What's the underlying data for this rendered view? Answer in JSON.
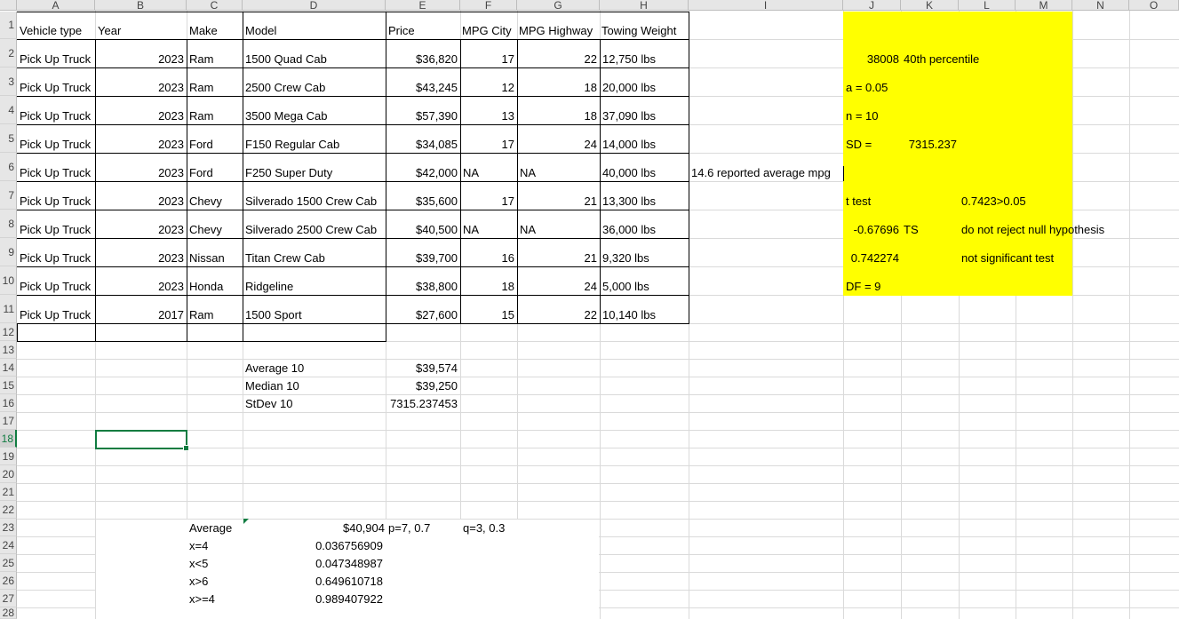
{
  "columns": [
    "A",
    "B",
    "C",
    "D",
    "E",
    "F",
    "G",
    "H",
    "I",
    "J",
    "K",
    "L",
    "M",
    "N",
    "O"
  ],
  "rows": [
    "1",
    "2",
    "3",
    "4",
    "5",
    "6",
    "7",
    "8",
    "9",
    "10",
    "11",
    "12",
    "13",
    "14",
    "15",
    "16",
    "17",
    "18",
    "19",
    "20",
    "21",
    "22",
    "23",
    "24",
    "25",
    "26",
    "27",
    "28"
  ],
  "selected_row": "18",
  "headers": {
    "vehicle_type": "Vehicle type",
    "year": "Year",
    "make": "Make",
    "model": "Model",
    "price": "Price",
    "mpg_city": "MPG City",
    "mpg_highway": "MPG Highway",
    "towing": "Towing Weight"
  },
  "trucks": [
    {
      "type": "Pick Up Truck",
      "year": "2023",
      "make": "Ram",
      "model": "1500 Quad Cab",
      "price": "$36,820",
      "city": "17",
      "hwy": "22",
      "tow": "12,750 lbs"
    },
    {
      "type": "Pick Up Truck",
      "year": "2023",
      "make": "Ram",
      "model": "2500 Crew Cab",
      "price": "$43,245",
      "city": "12",
      "hwy": "18",
      "tow": "20,000 lbs"
    },
    {
      "type": "Pick Up Truck",
      "year": "2023",
      "make": "Ram",
      "model": "3500 Mega Cab",
      "price": "$57,390",
      "city": "13",
      "hwy": "18",
      "tow": "37,090 lbs"
    },
    {
      "type": "Pick Up Truck",
      "year": "2023",
      "make": "Ford",
      "model": "F150 Regular Cab",
      "price": "$34,085",
      "city": "17",
      "hwy": "24",
      "tow": "14,000 lbs"
    },
    {
      "type": "Pick Up Truck",
      "year": "2023",
      "make": "Ford",
      "model": "F250 Super Duty",
      "price": "$42,000",
      "city": "NA",
      "hwy": "NA",
      "tow": "40,000 lbs"
    },
    {
      "type": "Pick Up Truck",
      "year": "2023",
      "make": "Chevy",
      "model": "Silverado 1500 Crew Cab",
      "price": "$35,600",
      "city": "17",
      "hwy": "21",
      "tow": "13,300 lbs"
    },
    {
      "type": "Pick Up Truck",
      "year": "2023",
      "make": "Chevy",
      "model": "Silverado 2500 Crew Cab",
      "price": "$40,500",
      "city": "NA",
      "hwy": "NA",
      "tow": "36,000 lbs"
    },
    {
      "type": "Pick Up Truck",
      "year": "2023",
      "make": "Nissan",
      "model": "Titan Crew Cab",
      "price": "$39,700",
      "city": "16",
      "hwy": "21",
      "tow": "9,320 lbs"
    },
    {
      "type": "Pick Up Truck",
      "year": "2023",
      "make": "Honda",
      "model": "Ridgeline",
      "price": "$38,800",
      "city": "18",
      "hwy": "24",
      "tow": "5,000 lbs"
    },
    {
      "type": "Pick Up Truck",
      "year": "2017",
      "make": "Ram",
      "model": "1500 Sport",
      "price": "$27,600",
      "city": "15",
      "hwy": "22",
      "tow": "10,140 lbs"
    }
  ],
  "note_mpg": "14.6 reported average mpg",
  "stats": {
    "average_label": "Average 10",
    "average_value": "$39,574",
    "median_label": "Median 10",
    "median_value": "$39,250",
    "stdev_label": "StDev 10",
    "stdev_value": "7315.237453"
  },
  "hypothesis": {
    "value_38008": "38008",
    "percentile": "40th percentile",
    "alpha": "a = 0.05",
    "n": "n = 10",
    "sd_label": "SD =",
    "sd_value": "7315.237",
    "ttest": "t test",
    "compare": "0.7423>0.05",
    "ts_value": "-0.67696",
    "ts_label": "TS",
    "conclusion": "do not reject null hypothesis",
    "pvalue": "0.742274",
    "significance": "not significant test",
    "df": "DF = 9"
  },
  "binomial": {
    "average_label": "Average",
    "average_value": "$40,904",
    "p": "p=7, 0.7",
    "q": "q=3, 0.3",
    "rows": [
      {
        "label": "x=4",
        "value": "0.036756909"
      },
      {
        "label": "x<5",
        "value": "0.047348987"
      },
      {
        "label": "x>6",
        "value": "0.649610718"
      },
      {
        "label": "x>=4",
        "value": "0.989407922"
      }
    ]
  },
  "colors": {
    "highlight": "#ffff00",
    "selection": "#107c41",
    "grid": "#dadada"
  }
}
